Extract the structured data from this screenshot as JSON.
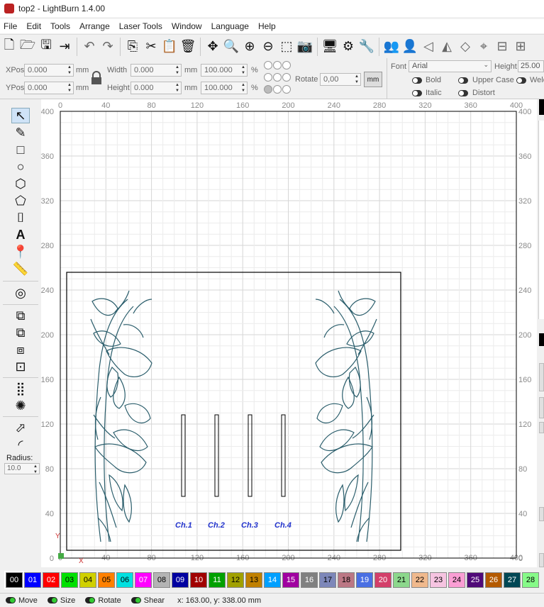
{
  "window": {
    "title": "top2 - LightBurn 1.4.00"
  },
  "menu": [
    "File",
    "Edit",
    "Tools",
    "Arrange",
    "Laser Tools",
    "Window",
    "Language",
    "Help"
  ],
  "props": {
    "xpos_label": "XPos",
    "xpos_value": "0.000",
    "ypos_label": "YPos",
    "ypos_value": "0.000",
    "unit_mm": "mm",
    "width_label": "Width",
    "width_value": "0.000",
    "height_label": "Height",
    "height_value": "0.000",
    "scale_w": "100.000",
    "scale_h": "100.000",
    "pct": "%",
    "rotate_label": "Rotate",
    "rotate_value": "0,00",
    "mm_button": "mm",
    "font_label": "Font",
    "font_value": "Arial",
    "font_height_label": "Height",
    "font_height_value": "25.00",
    "bold": "Bold",
    "italic": "Italic",
    "upper_case": "Upper Case",
    "distort": "Distort",
    "weld": "Weld"
  },
  "left": {
    "radius_label": "Radius:",
    "radius_value": "10.0"
  },
  "ruler": {
    "x_ticks": [
      "0",
      "40",
      "80",
      "120",
      "160",
      "200",
      "240",
      "280",
      "320",
      "360",
      "400"
    ],
    "y_ticks": [
      "400",
      "360",
      "320",
      "280",
      "240",
      "200",
      "160",
      "120",
      "80",
      "40",
      "0"
    ],
    "x_axis": "X",
    "y_axis": "Y"
  },
  "channel_labels": [
    "Ch.1",
    "Ch.2",
    "Ch.3",
    "Ch.4"
  ],
  "palette": [
    {
      "label": "00",
      "color": "#000000",
      "text": "#ffffff"
    },
    {
      "label": "01",
      "color": "#0000ff",
      "text": "#ffffff"
    },
    {
      "label": "02",
      "color": "#ff0000",
      "text": "#ffffff"
    },
    {
      "label": "03",
      "color": "#00e000",
      "text": "#000000"
    },
    {
      "label": "04",
      "color": "#d0d000",
      "text": "#000000"
    },
    {
      "label": "05",
      "color": "#ff8000",
      "text": "#000000"
    },
    {
      "label": "06",
      "color": "#00e0e0",
      "text": "#000000"
    },
    {
      "label": "07",
      "color": "#ff00ff",
      "text": "#ffffff"
    },
    {
      "label": "08",
      "color": "#b4b4b4",
      "text": "#000000"
    },
    {
      "label": "09",
      "color": "#0000a0",
      "text": "#ffffff"
    },
    {
      "label": "10",
      "color": "#a00000",
      "text": "#ffffff"
    },
    {
      "label": "11",
      "color": "#00a000",
      "text": "#ffffff"
    },
    {
      "label": "12",
      "color": "#a0a000",
      "text": "#000000"
    },
    {
      "label": "13",
      "color": "#c08000",
      "text": "#000000"
    },
    {
      "label": "14",
      "color": "#00a0ff",
      "text": "#ffffff"
    },
    {
      "label": "15",
      "color": "#a000a0",
      "text": "#ffffff"
    },
    {
      "label": "16",
      "color": "#808080",
      "text": "#ffffff"
    },
    {
      "label": "17",
      "color": "#7d87b9",
      "text": "#000000"
    },
    {
      "label": "18",
      "color": "#bb7784",
      "text": "#000000"
    },
    {
      "label": "19",
      "color": "#4a6fe3",
      "text": "#ffffff"
    },
    {
      "label": "20",
      "color": "#d33f6a",
      "text": "#ffffff"
    },
    {
      "label": "21",
      "color": "#8cd78c",
      "text": "#000000"
    },
    {
      "label": "22",
      "color": "#f0b98d",
      "text": "#000000"
    },
    {
      "label": "23",
      "color": "#f6c4e1",
      "text": "#000000"
    },
    {
      "label": "24",
      "color": "#fa9ed4",
      "text": "#000000"
    },
    {
      "label": "25",
      "color": "#500a78",
      "text": "#ffffff"
    },
    {
      "label": "26",
      "color": "#b45a00",
      "text": "#ffffff"
    },
    {
      "label": "27",
      "color": "#004754",
      "text": "#ffffff"
    },
    {
      "label": "28",
      "color": "#86fa88",
      "text": "#000000"
    }
  ],
  "status": {
    "move": "Move",
    "size": "Size",
    "rotate": "Rotate",
    "shear": "Shear",
    "coords": "x: 163.00, y: 338.00 mm"
  },
  "colors": {
    "design": "#2a5d6b",
    "text": "#2233cc",
    "frame": "#000000",
    "grid": "#e4e4e4"
  }
}
